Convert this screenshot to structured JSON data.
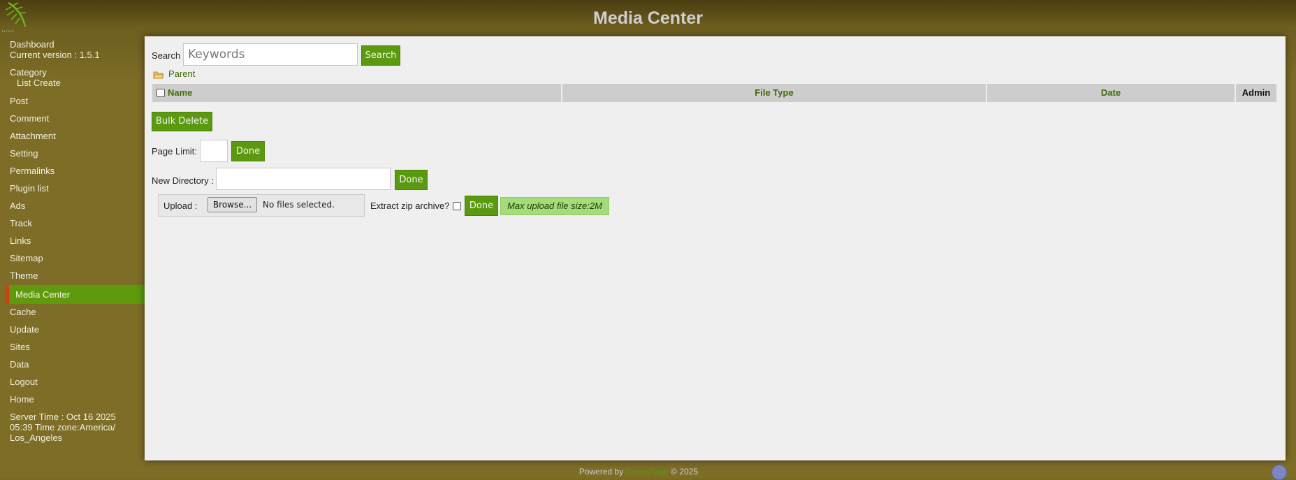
{
  "header": {
    "title": "Media Center",
    "logo_dots": "......"
  },
  "sidebar": {
    "dashboard": "Dashboard",
    "version": "Current version : 1.5.1",
    "category": "Category",
    "category_sub": "List Create",
    "items": [
      "Post",
      "Comment",
      "Attachment",
      "Setting",
      "Permalinks",
      "Plugin list",
      "Ads",
      "Track",
      "Links",
      "Sitemap",
      "Theme",
      "Media Center",
      "Cache",
      "Update",
      "Sites",
      "Data",
      "Logout",
      "Home"
    ],
    "active": "Media Center",
    "server_time_line1": "Server Time : Oct 16 2025",
    "server_time_line2": "05:39 Time zone:America/",
    "server_time_line3": "Los_Angeles"
  },
  "search": {
    "label": "Search",
    "placeholder": "Keywords",
    "button": "Search"
  },
  "parent_link": "Parent",
  "table": {
    "columns": [
      "Name",
      "File Type",
      "Date",
      "Admin"
    ],
    "rows": []
  },
  "bulk_delete": "Bulk Delete",
  "page_limit": {
    "label": "Page Limit:",
    "value": "",
    "button": "Done"
  },
  "new_directory": {
    "label": "New Directory :",
    "value": "",
    "button": "Done"
  },
  "upload": {
    "label": "Upload :",
    "browse": "Browse...",
    "status": "No files selected.",
    "extract_label": "Extract zip archive?",
    "extract_checked": false,
    "button": "Done",
    "max_size": "Max upload file size:2M"
  },
  "footer": {
    "prefix": "Powered by",
    "brand": "GreenPage",
    "suffix": "© 2025"
  },
  "colors": {
    "accent": "#5b9a10",
    "active_marker": "#d43b16",
    "sidebar_bg": "#7d6d27",
    "panel_bg": "#efefef"
  }
}
